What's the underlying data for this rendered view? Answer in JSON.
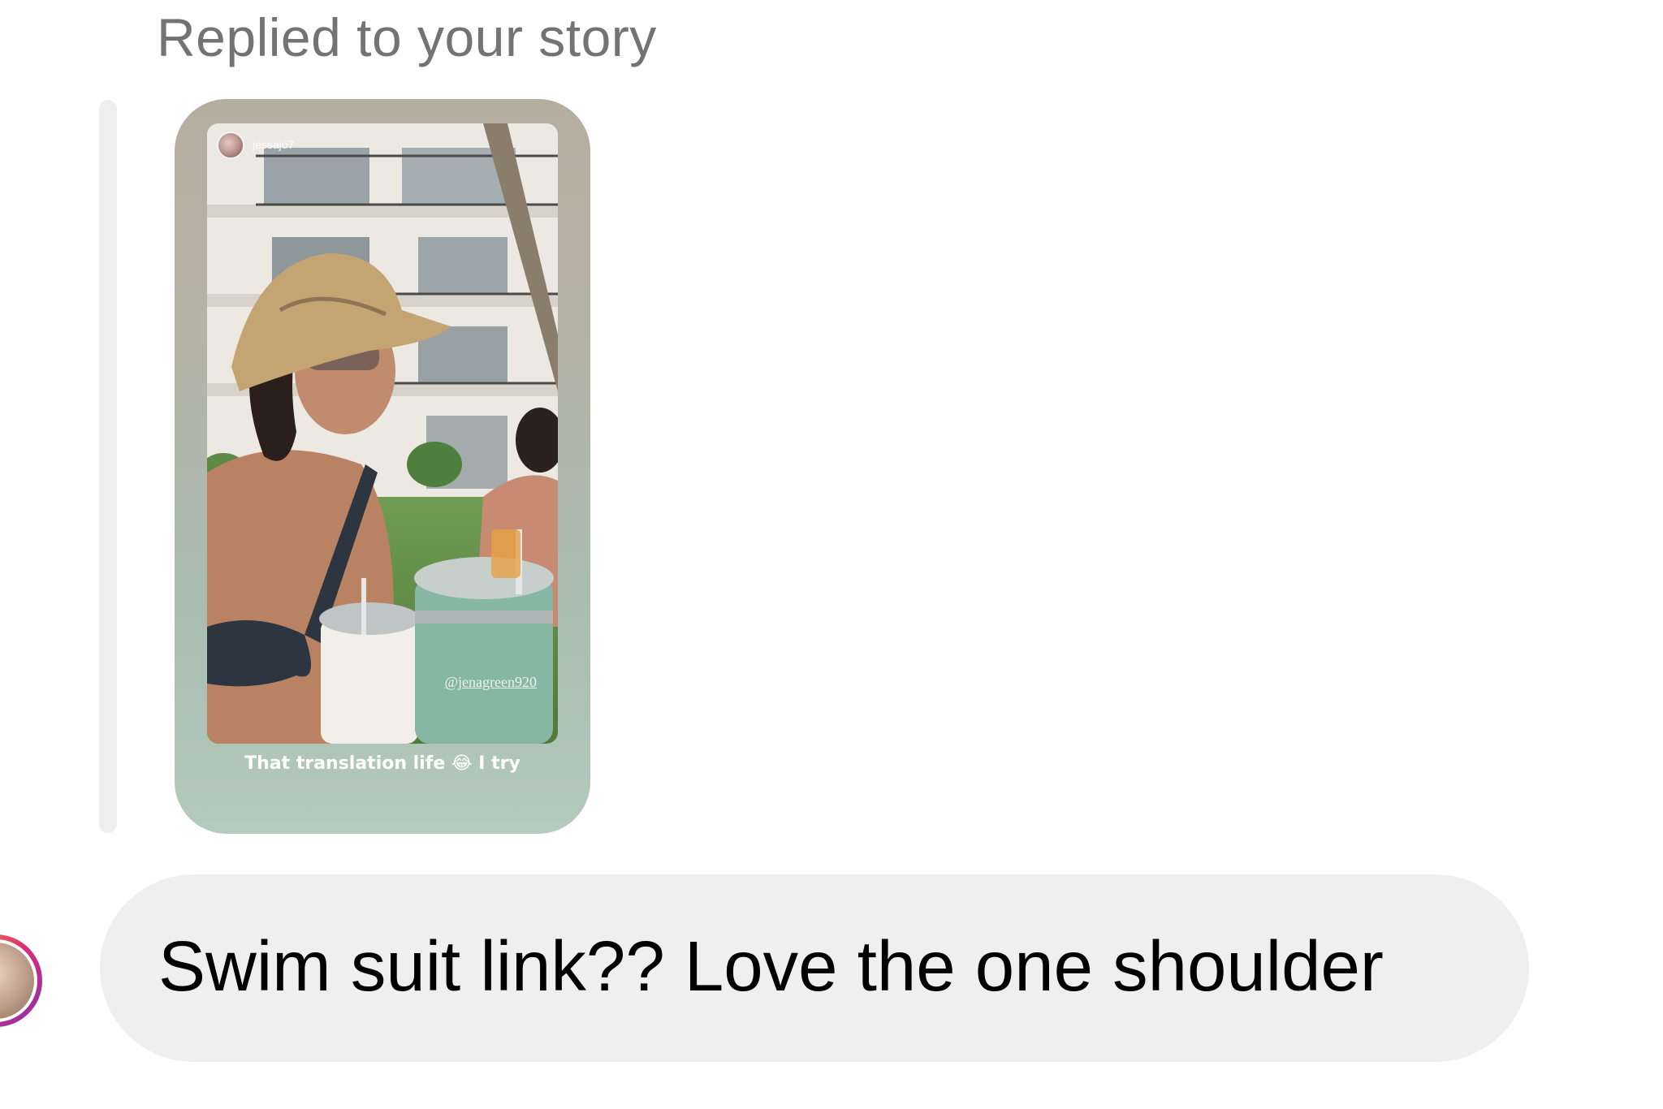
{
  "reply_context": {
    "label": "Replied to your story"
  },
  "story": {
    "username": "jessajo7",
    "watermark": "@jenagreen920",
    "caption": "That translation life 😂 I try"
  },
  "message": {
    "text": "Swim suit link?? Love the one shoulder"
  },
  "colors": {
    "bubble_background": "#efefef",
    "label_text": "#737373",
    "message_text": "#000000",
    "story_frame_top": "#b6ada0",
    "story_frame_bottom": "#b4cabd"
  },
  "icons": {
    "sender_avatar": "profile-photo",
    "story_author_avatar": "profile-photo"
  }
}
